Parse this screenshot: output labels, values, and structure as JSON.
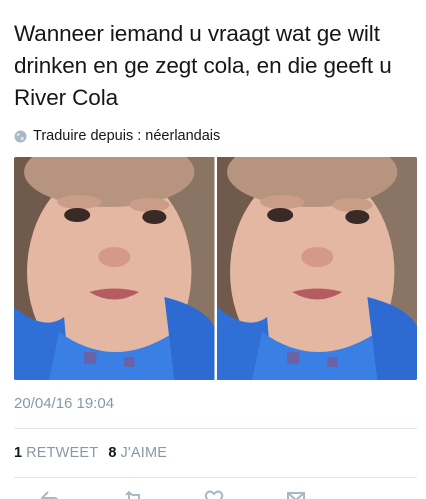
{
  "tweet": {
    "text": "Wanneer iemand u vraagt wat ge wilt drinken en ge zegt cola, en die geeft u River Cola",
    "translate_label": "Traduire depuis : néerlandais",
    "timestamp": "20/04/16 19:04"
  },
  "stats": {
    "retweet_count": "1",
    "retweet_label": "RETWEET",
    "like_count": "8",
    "like_label": "J'AIME"
  },
  "colors": {
    "text": "#14171a",
    "muted": "#8899a6",
    "divider": "#e1e8ed"
  },
  "icons": {
    "translate": "globe-icon",
    "reply": "reply-icon",
    "retweet": "retweet-icon",
    "like": "heart-icon",
    "share": "share-icon"
  }
}
